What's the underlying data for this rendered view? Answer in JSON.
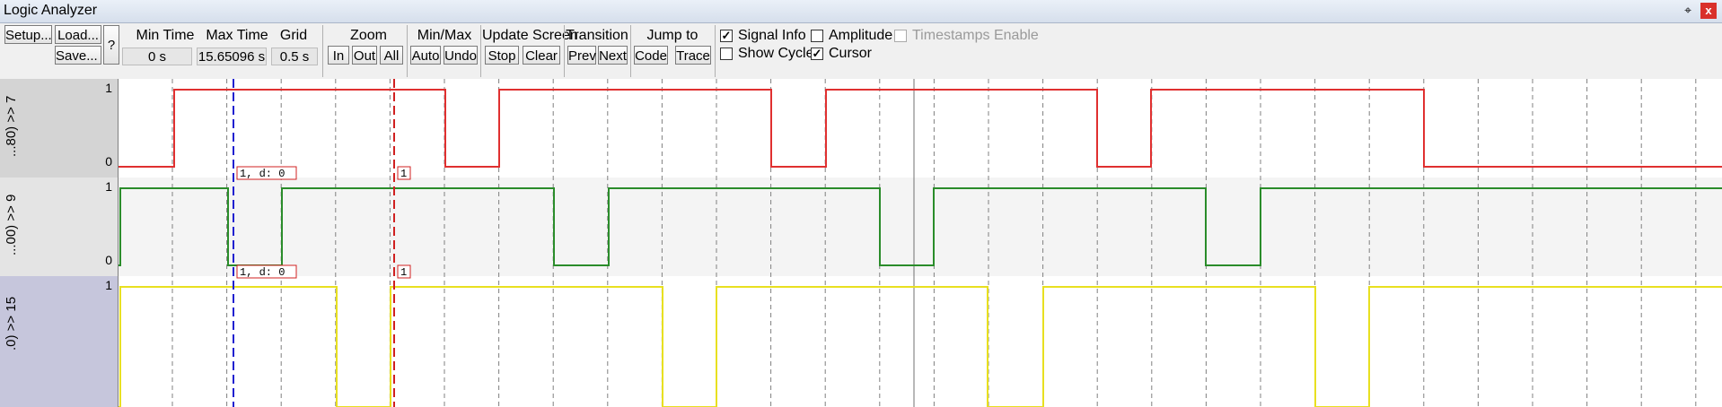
{
  "window": {
    "title": "Logic Analyzer",
    "pin_glyph": "⌖",
    "close_glyph": "x"
  },
  "toolbar": {
    "setup": "Setup...",
    "load": "Load...",
    "save": "Save...",
    "help": "?",
    "min_time": {
      "label": "Min Time",
      "value": "0 s"
    },
    "max_time": {
      "label": "Max Time",
      "value": "15.65096 s"
    },
    "grid": {
      "label": "Grid",
      "value": "0.5 s"
    },
    "zoom": {
      "label": "Zoom",
      "in": "In",
      "out": "Out",
      "all": "All"
    },
    "minmax": {
      "label": "Min/Max",
      "auto": "Auto",
      "undo": "Undo"
    },
    "update": {
      "label": "Update Screen",
      "stop": "Stop",
      "clear": "Clear"
    },
    "transition": {
      "label": "Transition",
      "prev": "Prev",
      "next": "Next"
    },
    "jump": {
      "label": "Jump to",
      "code": "Code",
      "trace": "Trace"
    },
    "options": {
      "signal_info": {
        "label": "Signal Info",
        "checked": true
      },
      "amplitude": {
        "label": "Amplitude",
        "checked": false
      },
      "timestamps": {
        "label": "Timestamps Enable",
        "checked": false,
        "disabled": true
      },
      "show_cycles": {
        "label": "Show Cycles",
        "checked": false
      },
      "cursor": {
        "label": "Cursor",
        "checked": true
      }
    }
  },
  "signals": [
    {
      "name": "...80) >> 7",
      "high": "1",
      "low": "0",
      "color": "#e03030",
      "marker_label": "1,  d: 0",
      "cursor_label": "1"
    },
    {
      "name": "...00) >> 9",
      "high": "1",
      "low": "0",
      "color": "#2a8c2a",
      "marker_label": "1,  d: 0",
      "cursor_label": "1"
    },
    {
      "name": ".0) >> 15",
      "high": "1",
      "low": "",
      "color": "#e8e020",
      "marker_label": "",
      "cursor_label": ""
    }
  ],
  "colors": {
    "plot_bg": "#ffffff",
    "grid": "#808080",
    "marker_blue": "#2020d0",
    "marker_red": "#d02020"
  }
}
